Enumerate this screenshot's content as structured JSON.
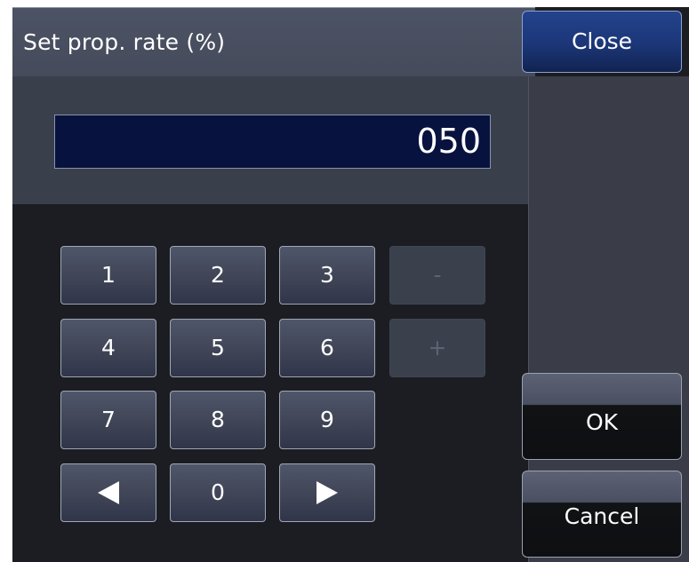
{
  "dialog": {
    "title": "Set prop. rate (%)",
    "close_label": "Close",
    "value": "050"
  },
  "keypad": {
    "keys": [
      "1",
      "2",
      "3",
      "-",
      "4",
      "5",
      "6",
      "+",
      "7",
      "8",
      "9",
      "0"
    ],
    "disabled_keys": [
      "-",
      "+"
    ],
    "left_arrow_icon": "triangle-left-icon",
    "right_arrow_icon": "triangle-right-icon"
  },
  "actions": {
    "ok_label": "OK",
    "cancel_label": "Cancel"
  },
  "colors": {
    "close_button": "#1c3678",
    "display_background": "#07123e",
    "screen_background": "#1b1d22"
  }
}
